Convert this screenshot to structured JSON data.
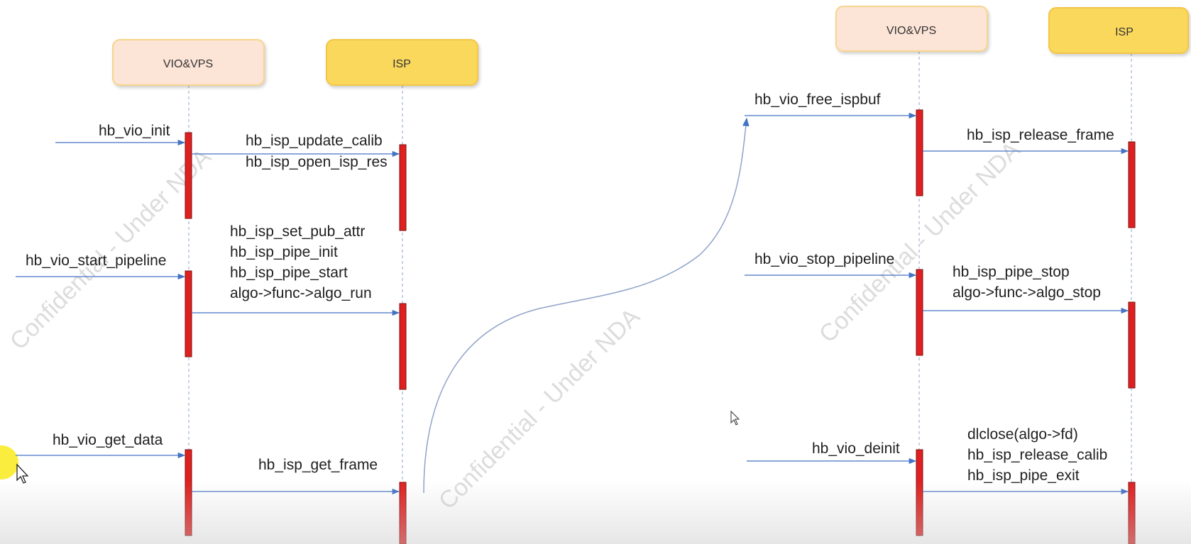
{
  "colors": {
    "vio_box_fill": "#fce4d6",
    "vio_box_border": "#f7d58c",
    "isp_box_fill": "#f9d85b",
    "isp_box_border": "#f2c64a",
    "activation": "#e02020",
    "arrow": "#4472c4",
    "lifeline": "#8fa3c8"
  },
  "left_diagram": {
    "vio_label": "VIO&VPS",
    "isp_label": "ISP",
    "msg_init": "hb_vio_init",
    "msg_update_calib": "hb_isp_update_calib",
    "msg_open_isp_res": "hb_isp_open_isp_res",
    "msg_start_pipeline": "hb_vio_start_pipeline",
    "msg_set_pub_attr": "hb_isp_set_pub_attr",
    "msg_pipe_init": "hb_isp_pipe_init",
    "msg_pipe_start": "hb_isp_pipe_start",
    "msg_algo_run": "algo->func->algo_run",
    "msg_get_data": "hb_vio_get_data",
    "msg_get_frame": "hb_isp_get_frame"
  },
  "right_diagram": {
    "vio_label": "VIO&VPS",
    "isp_label": "ISP",
    "msg_free_ispbuf": "hb_vio_free_ispbuf",
    "msg_release_frame": "hb_isp_release_frame",
    "msg_stop_pipeline": "hb_vio_stop_pipeline",
    "msg_pipe_stop": "hb_isp_pipe_stop",
    "msg_algo_stop": "algo->func->algo_stop",
    "msg_deinit": "hb_vio_deinit",
    "msg_dlclose": "dlclose(algo->fd)",
    "msg_release_calib": "hb_isp_release_calib",
    "msg_pipe_exit": "hb_isp_pipe_exit"
  },
  "watermark": {
    "text": "Confidential - Under NDA"
  },
  "icons": {
    "pointer": "mouse-pointer-icon",
    "cursor_highlight": "cursor-highlight-icon"
  }
}
